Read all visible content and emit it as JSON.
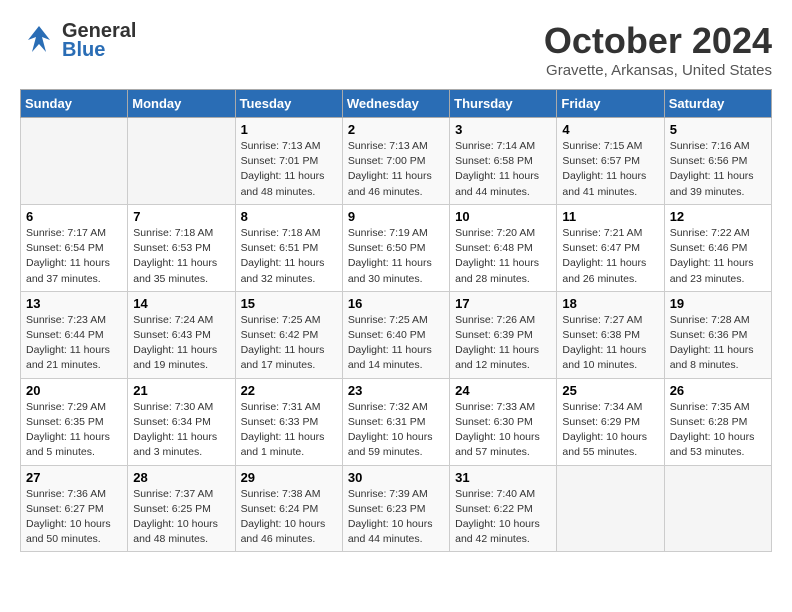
{
  "header": {
    "logo_general": "General",
    "logo_blue": "Blue",
    "month_title": "October 2024",
    "location": "Gravette, Arkansas, United States"
  },
  "days_of_week": [
    "Sunday",
    "Monday",
    "Tuesday",
    "Wednesday",
    "Thursday",
    "Friday",
    "Saturday"
  ],
  "weeks": [
    [
      {
        "day": "",
        "sunrise": "",
        "sunset": "",
        "daylight": ""
      },
      {
        "day": "",
        "sunrise": "",
        "sunset": "",
        "daylight": ""
      },
      {
        "day": "1",
        "sunrise": "Sunrise: 7:13 AM",
        "sunset": "Sunset: 7:01 PM",
        "daylight": "Daylight: 11 hours and 48 minutes."
      },
      {
        "day": "2",
        "sunrise": "Sunrise: 7:13 AM",
        "sunset": "Sunset: 7:00 PM",
        "daylight": "Daylight: 11 hours and 46 minutes."
      },
      {
        "day": "3",
        "sunrise": "Sunrise: 7:14 AM",
        "sunset": "Sunset: 6:58 PM",
        "daylight": "Daylight: 11 hours and 44 minutes."
      },
      {
        "day": "4",
        "sunrise": "Sunrise: 7:15 AM",
        "sunset": "Sunset: 6:57 PM",
        "daylight": "Daylight: 11 hours and 41 minutes."
      },
      {
        "day": "5",
        "sunrise": "Sunrise: 7:16 AM",
        "sunset": "Sunset: 6:56 PM",
        "daylight": "Daylight: 11 hours and 39 minutes."
      }
    ],
    [
      {
        "day": "6",
        "sunrise": "Sunrise: 7:17 AM",
        "sunset": "Sunset: 6:54 PM",
        "daylight": "Daylight: 11 hours and 37 minutes."
      },
      {
        "day": "7",
        "sunrise": "Sunrise: 7:18 AM",
        "sunset": "Sunset: 6:53 PM",
        "daylight": "Daylight: 11 hours and 35 minutes."
      },
      {
        "day": "8",
        "sunrise": "Sunrise: 7:18 AM",
        "sunset": "Sunset: 6:51 PM",
        "daylight": "Daylight: 11 hours and 32 minutes."
      },
      {
        "day": "9",
        "sunrise": "Sunrise: 7:19 AM",
        "sunset": "Sunset: 6:50 PM",
        "daylight": "Daylight: 11 hours and 30 minutes."
      },
      {
        "day": "10",
        "sunrise": "Sunrise: 7:20 AM",
        "sunset": "Sunset: 6:48 PM",
        "daylight": "Daylight: 11 hours and 28 minutes."
      },
      {
        "day": "11",
        "sunrise": "Sunrise: 7:21 AM",
        "sunset": "Sunset: 6:47 PM",
        "daylight": "Daylight: 11 hours and 26 minutes."
      },
      {
        "day": "12",
        "sunrise": "Sunrise: 7:22 AM",
        "sunset": "Sunset: 6:46 PM",
        "daylight": "Daylight: 11 hours and 23 minutes."
      }
    ],
    [
      {
        "day": "13",
        "sunrise": "Sunrise: 7:23 AM",
        "sunset": "Sunset: 6:44 PM",
        "daylight": "Daylight: 11 hours and 21 minutes."
      },
      {
        "day": "14",
        "sunrise": "Sunrise: 7:24 AM",
        "sunset": "Sunset: 6:43 PM",
        "daylight": "Daylight: 11 hours and 19 minutes."
      },
      {
        "day": "15",
        "sunrise": "Sunrise: 7:25 AM",
        "sunset": "Sunset: 6:42 PM",
        "daylight": "Daylight: 11 hours and 17 minutes."
      },
      {
        "day": "16",
        "sunrise": "Sunrise: 7:25 AM",
        "sunset": "Sunset: 6:40 PM",
        "daylight": "Daylight: 11 hours and 14 minutes."
      },
      {
        "day": "17",
        "sunrise": "Sunrise: 7:26 AM",
        "sunset": "Sunset: 6:39 PM",
        "daylight": "Daylight: 11 hours and 12 minutes."
      },
      {
        "day": "18",
        "sunrise": "Sunrise: 7:27 AM",
        "sunset": "Sunset: 6:38 PM",
        "daylight": "Daylight: 11 hours and 10 minutes."
      },
      {
        "day": "19",
        "sunrise": "Sunrise: 7:28 AM",
        "sunset": "Sunset: 6:36 PM",
        "daylight": "Daylight: 11 hours and 8 minutes."
      }
    ],
    [
      {
        "day": "20",
        "sunrise": "Sunrise: 7:29 AM",
        "sunset": "Sunset: 6:35 PM",
        "daylight": "Daylight: 11 hours and 5 minutes."
      },
      {
        "day": "21",
        "sunrise": "Sunrise: 7:30 AM",
        "sunset": "Sunset: 6:34 PM",
        "daylight": "Daylight: 11 hours and 3 minutes."
      },
      {
        "day": "22",
        "sunrise": "Sunrise: 7:31 AM",
        "sunset": "Sunset: 6:33 PM",
        "daylight": "Daylight: 11 hours and 1 minute."
      },
      {
        "day": "23",
        "sunrise": "Sunrise: 7:32 AM",
        "sunset": "Sunset: 6:31 PM",
        "daylight": "Daylight: 10 hours and 59 minutes."
      },
      {
        "day": "24",
        "sunrise": "Sunrise: 7:33 AM",
        "sunset": "Sunset: 6:30 PM",
        "daylight": "Daylight: 10 hours and 57 minutes."
      },
      {
        "day": "25",
        "sunrise": "Sunrise: 7:34 AM",
        "sunset": "Sunset: 6:29 PM",
        "daylight": "Daylight: 10 hours and 55 minutes."
      },
      {
        "day": "26",
        "sunrise": "Sunrise: 7:35 AM",
        "sunset": "Sunset: 6:28 PM",
        "daylight": "Daylight: 10 hours and 53 minutes."
      }
    ],
    [
      {
        "day": "27",
        "sunrise": "Sunrise: 7:36 AM",
        "sunset": "Sunset: 6:27 PM",
        "daylight": "Daylight: 10 hours and 50 minutes."
      },
      {
        "day": "28",
        "sunrise": "Sunrise: 7:37 AM",
        "sunset": "Sunset: 6:25 PM",
        "daylight": "Daylight: 10 hours and 48 minutes."
      },
      {
        "day": "29",
        "sunrise": "Sunrise: 7:38 AM",
        "sunset": "Sunset: 6:24 PM",
        "daylight": "Daylight: 10 hours and 46 minutes."
      },
      {
        "day": "30",
        "sunrise": "Sunrise: 7:39 AM",
        "sunset": "Sunset: 6:23 PM",
        "daylight": "Daylight: 10 hours and 44 minutes."
      },
      {
        "day": "31",
        "sunrise": "Sunrise: 7:40 AM",
        "sunset": "Sunset: 6:22 PM",
        "daylight": "Daylight: 10 hours and 42 minutes."
      },
      {
        "day": "",
        "sunrise": "",
        "sunset": "",
        "daylight": ""
      },
      {
        "day": "",
        "sunrise": "",
        "sunset": "",
        "daylight": ""
      }
    ]
  ]
}
